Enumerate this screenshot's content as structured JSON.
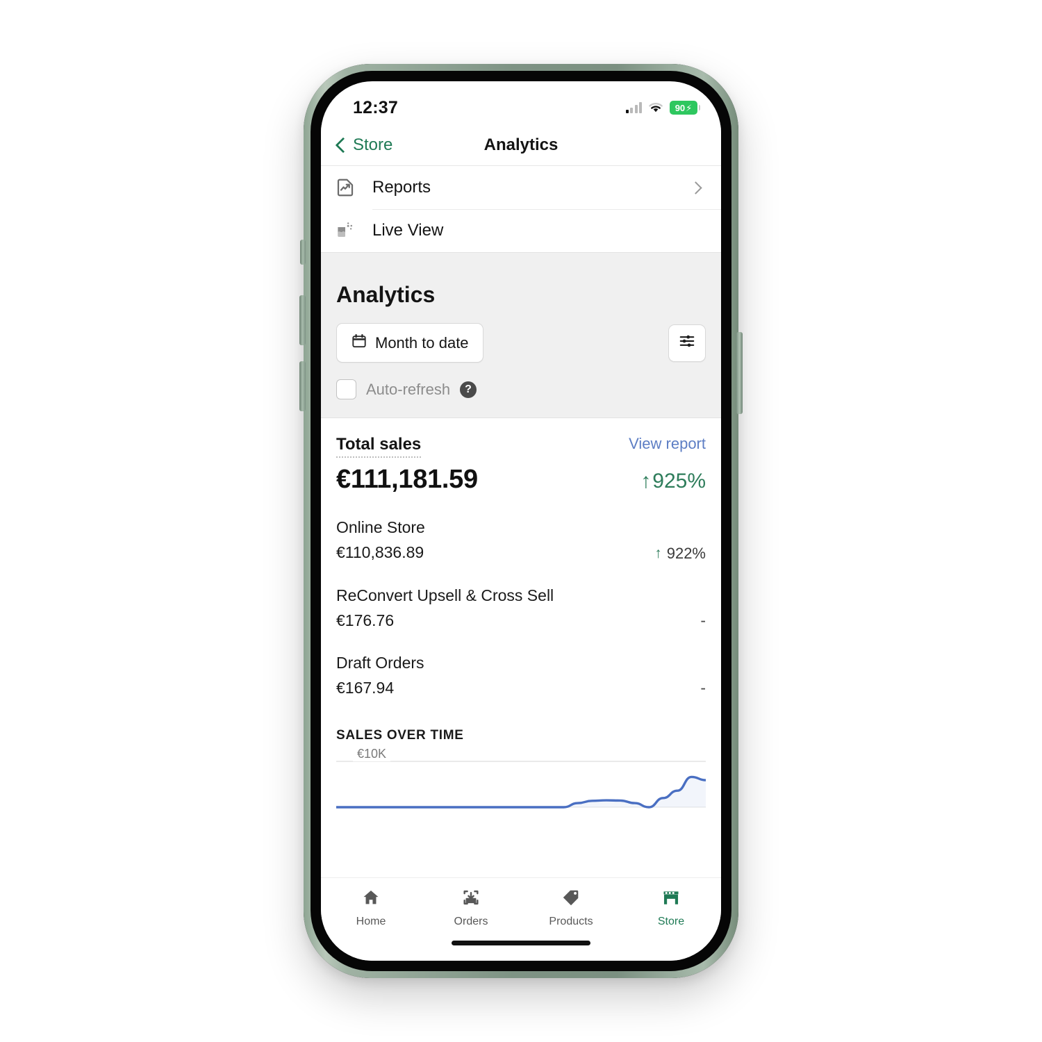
{
  "status_bar": {
    "time": "12:37",
    "signal_icon": "cellular-signal-icon",
    "wifi_icon": "wifi-icon",
    "battery_level": "90",
    "battery_charging_icon": "lightning-bolt-icon"
  },
  "nav": {
    "back_label": "Store",
    "back_icon": "chevron-left-icon",
    "title": "Analytics"
  },
  "menu": {
    "items": [
      {
        "label": "Reports",
        "icon": "report-document-icon",
        "chevron": "chevron-right-icon",
        "has_chevron": true
      },
      {
        "label": "Live View",
        "icon": "live-view-icon",
        "chevron": "",
        "has_chevron": false
      }
    ]
  },
  "analytics_section": {
    "title": "Analytics",
    "date_range_label": "Month to date",
    "calendar_icon": "calendar-icon",
    "filter_icon": "sliders-filter-icon",
    "auto_refresh_label": "Auto-refresh",
    "auto_refresh_checked": false,
    "help_icon": "question-mark-icon",
    "help_glyph": "?"
  },
  "total_sales": {
    "metric_label": "Total sales",
    "view_report_label": "View report",
    "value": "€111,181.59",
    "delta": "925%",
    "delta_arrow": "↑",
    "delta_direction": "up"
  },
  "breakdown": [
    {
      "name": "Online Store",
      "value": "€110,836.89",
      "delta": "922%",
      "arrow": "↑",
      "has_delta": true,
      "dash": ""
    },
    {
      "name": "ReConvert Upsell & Cross Sell",
      "value": "€176.76",
      "delta": "",
      "arrow": "",
      "has_delta": false,
      "dash": "-"
    },
    {
      "name": "Draft Orders",
      "value": "€167.94",
      "delta": "",
      "arrow": "",
      "has_delta": false,
      "dash": "-"
    }
  ],
  "chart_data": {
    "type": "line",
    "title": "SALES OVER TIME",
    "axis_label": "€10K",
    "ylim": [
      0,
      10000
    ],
    "grid": true,
    "legend": "none",
    "line_color": "#4a6fc2",
    "x": [
      1,
      2,
      3,
      4,
      5,
      6,
      7,
      8,
      9,
      10,
      11,
      12,
      13,
      14,
      15,
      16,
      17,
      18,
      19,
      20,
      21,
      22,
      23,
      24,
      25,
      26,
      27
    ],
    "values": [
      0,
      0,
      0,
      0,
      0,
      0,
      0,
      0,
      0,
      0,
      0,
      0,
      0,
      0,
      0,
      0,
      0,
      900,
      1400,
      1500,
      1450,
      900,
      0,
      2000,
      3600,
      6600,
      5900
    ]
  },
  "tab_bar": {
    "tabs": [
      {
        "label": "Home",
        "icon": "home-icon",
        "active": false
      },
      {
        "label": "Orders",
        "icon": "orders-inbox-icon",
        "active": false
      },
      {
        "label": "Products",
        "icon": "price-tag-icon",
        "active": false
      },
      {
        "label": "Store",
        "icon": "storefront-icon",
        "active": true
      }
    ]
  },
  "colors": {
    "brand_green": "#1f7a55",
    "link_blue": "#5d7ec4",
    "positive_green": "#2e7d5b",
    "chart_blue": "#4a6fc2",
    "battery_green": "#2ec75f",
    "section_gray": "#f0f0f0"
  }
}
